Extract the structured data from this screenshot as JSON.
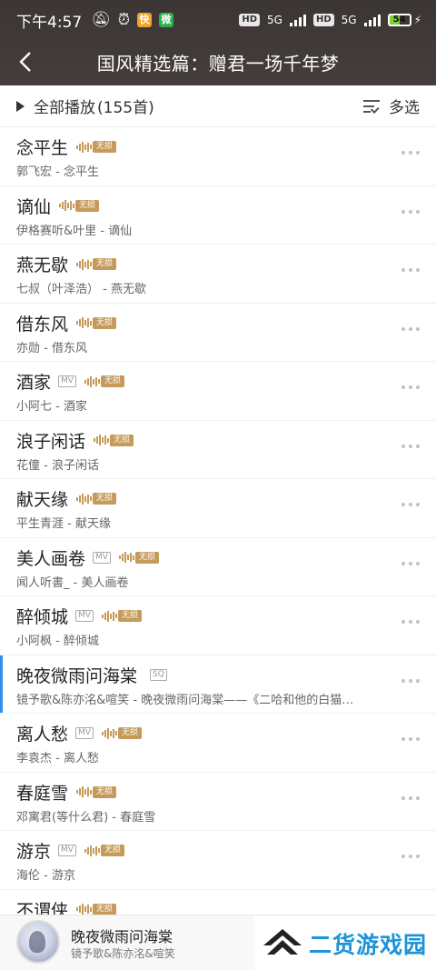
{
  "status": {
    "time": "下午4:57",
    "app_badges": [
      "快",
      "微"
    ],
    "net1": "5G",
    "net2": "5G",
    "hd1": "HD",
    "hd2": "HD",
    "battery": "54",
    "battery_level": 0.54
  },
  "header": {
    "title": "国风精选篇：赠君一场千年梦"
  },
  "toolbar": {
    "play_all_label": "全部播放",
    "count": "(155首)",
    "multi_select_label": "多选"
  },
  "badge_labels": {
    "lossless": "无损",
    "mv": "MV",
    "sq": "SQ"
  },
  "songs": [
    {
      "title": "念平生",
      "sub": "郭飞宏 - 念平生",
      "mv": false,
      "lossless": true,
      "sq": false,
      "active": false
    },
    {
      "title": "谪仙",
      "sub": "伊格赛听&叶里 - 谪仙",
      "mv": false,
      "lossless": true,
      "sq": false,
      "active": false
    },
    {
      "title": "燕无歇",
      "sub": "七叔（叶泽浩） - 燕无歇",
      "mv": false,
      "lossless": true,
      "sq": false,
      "active": false
    },
    {
      "title": "借东风",
      "sub": "亦勋 - 借东风",
      "mv": false,
      "lossless": true,
      "sq": false,
      "active": false
    },
    {
      "title": "酒家",
      "sub": "小阿七 - 酒家",
      "mv": true,
      "lossless": true,
      "sq": false,
      "active": false
    },
    {
      "title": "浪子闲话",
      "sub": "花僮 - 浪子闲话",
      "mv": false,
      "lossless": true,
      "sq": false,
      "active": false
    },
    {
      "title": "献天缘",
      "sub": "平生青涯 - 献天缘",
      "mv": false,
      "lossless": true,
      "sq": false,
      "active": false
    },
    {
      "title": "美人画卷",
      "sub": "闻人听書_ - 美人画卷",
      "mv": true,
      "lossless": true,
      "sq": false,
      "active": false
    },
    {
      "title": "醉倾城",
      "sub": "小阿枫 - 醉倾城",
      "mv": true,
      "lossless": true,
      "sq": false,
      "active": false
    },
    {
      "title": "晚夜微雨问海棠",
      "sub": "镜予歌&陈亦洺&喧笑 - 晚夜微雨问海棠——《二哈和他的白猫…",
      "mv": false,
      "lossless": false,
      "sq": true,
      "active": true
    },
    {
      "title": "离人愁",
      "sub": "李袁杰 - 离人愁",
      "mv": true,
      "lossless": true,
      "sq": false,
      "active": false
    },
    {
      "title": "春庭雪",
      "sub": "邓寓君(等什么君) - 春庭雪",
      "mv": false,
      "lossless": true,
      "sq": false,
      "active": false
    },
    {
      "title": "游京",
      "sub": "海伦 - 游京",
      "mv": true,
      "lossless": true,
      "sq": false,
      "active": false
    },
    {
      "title": "不谓侠",
      "sub": "",
      "mv": false,
      "lossless": true,
      "sq": false,
      "active": false
    }
  ],
  "player": {
    "title": "晚夜微雨问海棠",
    "artist": "镜予歌&陈亦洺&喧笑"
  },
  "watermark": {
    "text": "二货游戏园"
  },
  "colors": {
    "header_bg": "#3e3837",
    "accent_gold": "#c59a5a",
    "active_marker": "#2f8fe8",
    "watermark_blue": "#1d94d8"
  }
}
